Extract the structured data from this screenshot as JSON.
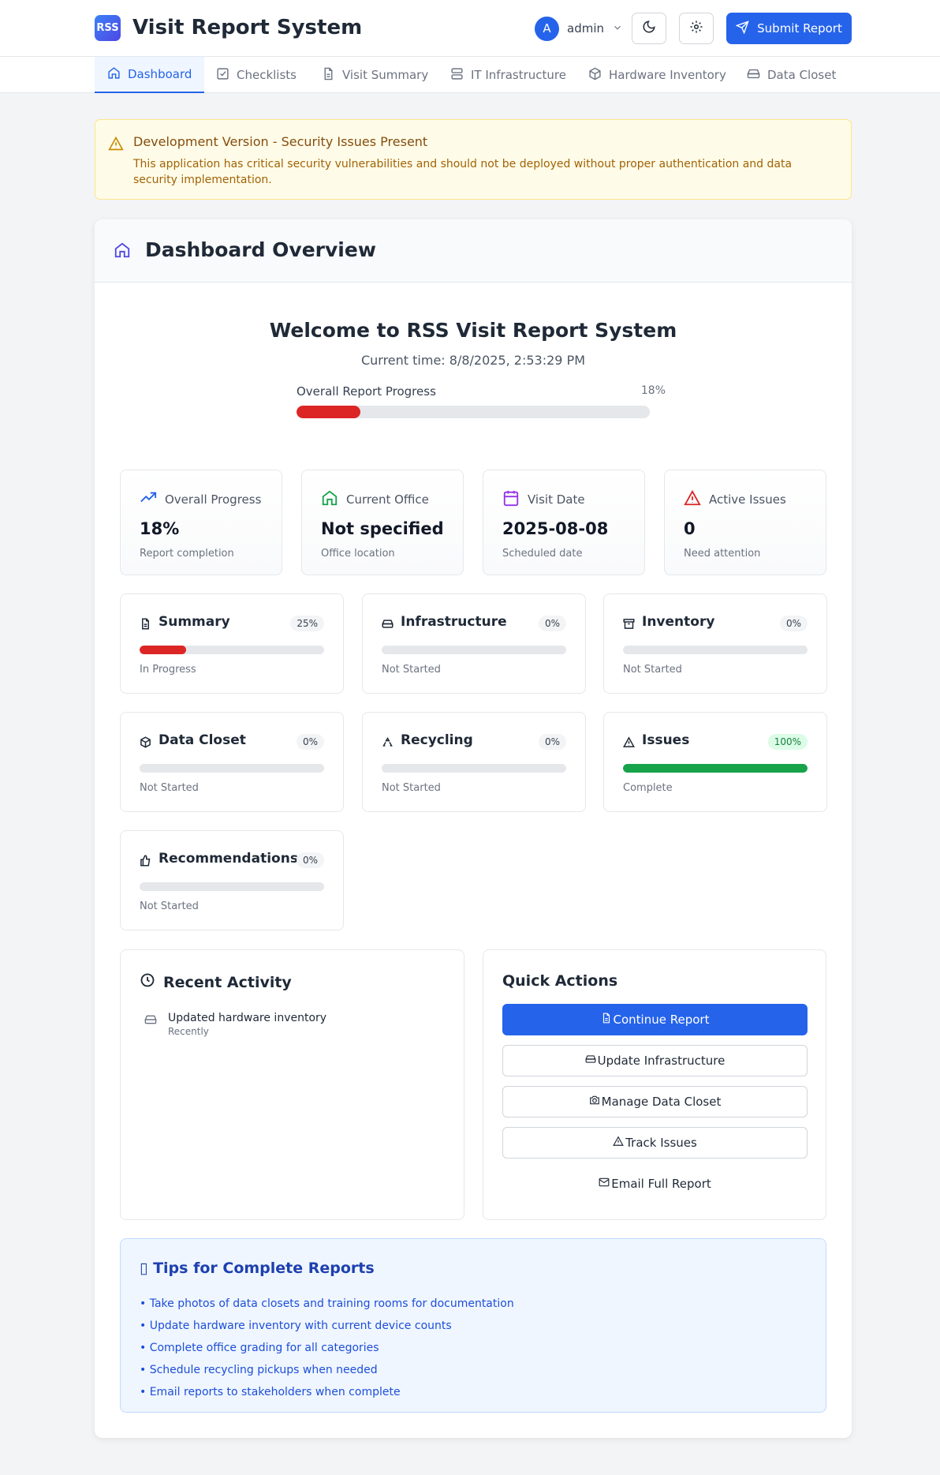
{
  "header": {
    "logo_text": "RSS",
    "title": "Visit Report System",
    "user_initial": "A",
    "username": "admin",
    "submit_label": "Submit Report"
  },
  "tabs": [
    {
      "label": "Dashboard",
      "icon": "home-icon",
      "active": true
    },
    {
      "label": "Checklists",
      "icon": "checkbox-icon"
    },
    {
      "label": "Visit Summary",
      "icon": "document-icon"
    },
    {
      "label": "IT Infrastructure",
      "icon": "server-icon"
    },
    {
      "label": "Hardware Inventory",
      "icon": "package-icon"
    },
    {
      "label": "Data Closet",
      "icon": "drive-icon"
    }
  ],
  "alert": {
    "title": "Development Version - Security Issues Present",
    "text": "This application has critical security vulnerabilities and should not be deployed without proper authentication and data security implementation."
  },
  "dashboard": {
    "title": "Dashboard Overview",
    "welcome": "Welcome to RSS Visit Report System",
    "current_time": "Current time: 8/8/2025, 2:53:29 PM",
    "progress_label": "Overall Report Progress",
    "progress_value": 18,
    "progress_text": "18%"
  },
  "stats": [
    {
      "label": "Overall Progress",
      "value": "18%",
      "sub": "Report completion",
      "icon": "trending-up-icon",
      "color": "#2563eb"
    },
    {
      "label": "Current Office",
      "value": "Not specified",
      "sub": "Office location",
      "icon": "home-icon",
      "color": "#16a34a"
    },
    {
      "label": "Visit Date",
      "value": "2025-08-08",
      "sub": "Scheduled date",
      "icon": "calendar-icon",
      "color": "#9333ea"
    },
    {
      "label": "Active Issues",
      "value": "0",
      "sub": "Need attention",
      "icon": "alert-triangle-icon",
      "color": "#dc2626"
    }
  ],
  "sections": [
    {
      "title": "Summary",
      "badge": "25%",
      "progress": 25,
      "status": "In Progress",
      "icon": "document-icon",
      "color": "#dc2626"
    },
    {
      "title": "Infrastructure",
      "badge": "0%",
      "progress": 0,
      "status": "Not Started",
      "icon": "drive-icon",
      "color": "#dc2626"
    },
    {
      "title": "Inventory",
      "badge": "0%",
      "progress": 0,
      "status": "Not Started",
      "icon": "archive-icon",
      "color": "#dc2626"
    },
    {
      "title": "Data Closet",
      "badge": "0%",
      "progress": 0,
      "status": "Not Started",
      "icon": "package-icon",
      "color": "#dc2626"
    },
    {
      "title": "Recycling",
      "badge": "0%",
      "progress": 0,
      "status": "Not Started",
      "icon": "recycle-icon",
      "color": "#dc2626"
    },
    {
      "title": "Issues",
      "badge": "100%",
      "progress": 100,
      "status": "Complete",
      "icon": "alert-triangle-icon",
      "color": "#16a34a"
    },
    {
      "title": "Recommendations",
      "badge": "0%",
      "progress": 0,
      "status": "Not Started",
      "icon": "thumbs-up-icon",
      "color": "#dc2626"
    }
  ],
  "recent_activity": {
    "title": "Recent Activity",
    "items": [
      {
        "text": "Updated hardware inventory",
        "time": "Recently",
        "icon": "drive-icon"
      }
    ]
  },
  "quick_actions": {
    "title": "Quick Actions",
    "buttons": [
      {
        "label": "Continue Report",
        "icon": "document-icon"
      },
      {
        "label": "Update Infrastructure",
        "icon": "drive-icon"
      },
      {
        "label": "Manage Data Closet",
        "icon": "camera-icon"
      },
      {
        "label": "Track Issues",
        "icon": "alert-triangle-icon"
      },
      {
        "label": "Email Full Report",
        "icon": "mail-icon"
      }
    ]
  },
  "tips": {
    "title": "▯ Tips for Complete Reports",
    "items": [
      "• Take photos of data closets and training rooms for documentation",
      "• Update hardware inventory with current device counts",
      "• Complete office grading for all categories",
      "• Schedule recycling pickups when needed",
      "• Email reports to stakeholders when complete"
    ]
  }
}
